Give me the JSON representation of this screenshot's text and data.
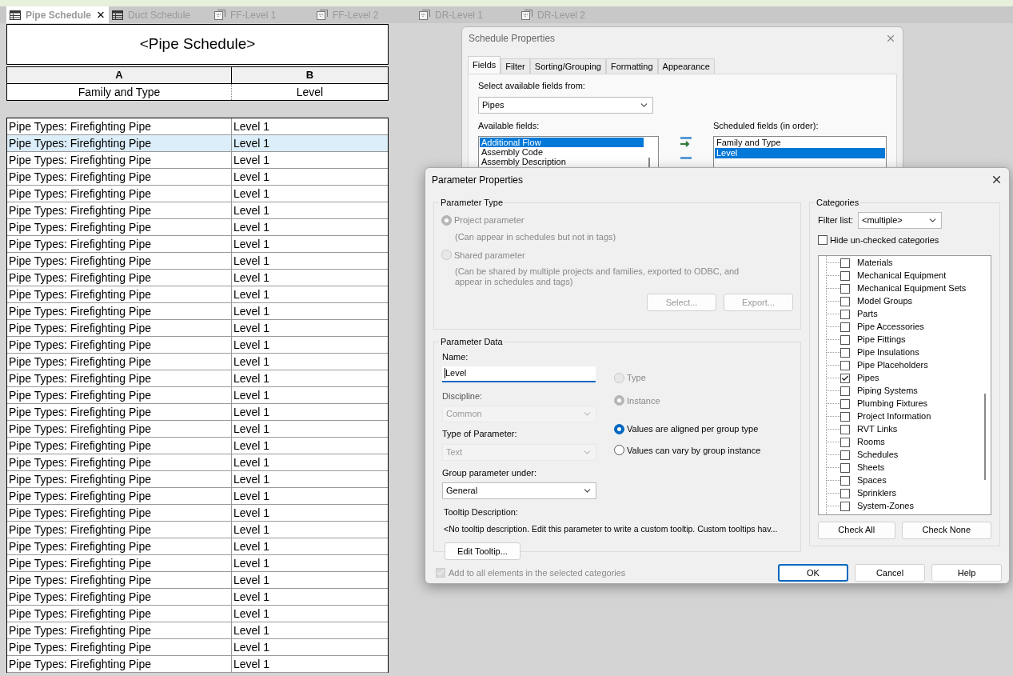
{
  "view_tabs": [
    {
      "label": "Pipe Schedule",
      "kind": "schedule",
      "selected": true
    },
    {
      "label": "Duct Schedule",
      "kind": "schedule",
      "selected": false
    },
    {
      "label": "FF-Level 1",
      "kind": "plan",
      "selected": false
    },
    {
      "label": "FF-Level 2",
      "kind": "plan",
      "selected": false
    },
    {
      "label": "DR-Level 1",
      "kind": "plan",
      "selected": false
    },
    {
      "label": "DR-Level 2",
      "kind": "plan",
      "selected": false
    }
  ],
  "schedule": {
    "title": "<Pipe Schedule>",
    "columns": [
      {
        "letter": "A",
        "heading": "Family and Type"
      },
      {
        "letter": "B",
        "heading": "Level"
      }
    ],
    "rows": [
      {
        "cells": [
          "Pipe Types: Firefighting Pipe",
          "Level 1"
        ],
        "selected": false
      },
      {
        "cells": [
          "Pipe Types: Firefighting Pipe",
          "Level 1"
        ],
        "selected": true
      },
      {
        "cells": [
          "Pipe Types: Firefighting Pipe",
          "Level 1"
        ],
        "selected": false
      },
      {
        "cells": [
          "Pipe Types: Firefighting Pipe",
          "Level 1"
        ],
        "selected": false
      },
      {
        "cells": [
          "Pipe Types: Firefighting Pipe",
          "Level 1"
        ],
        "selected": false
      },
      {
        "cells": [
          "Pipe Types: Firefighting Pipe",
          "Level 1"
        ],
        "selected": false
      },
      {
        "cells": [
          "Pipe Types: Firefighting Pipe",
          "Level 1"
        ],
        "selected": false
      },
      {
        "cells": [
          "Pipe Types: Firefighting Pipe",
          "Level 1"
        ],
        "selected": false
      },
      {
        "cells": [
          "Pipe Types: Firefighting Pipe",
          "Level 1"
        ],
        "selected": false
      },
      {
        "cells": [
          "Pipe Types: Firefighting Pipe",
          "Level 1"
        ],
        "selected": false
      },
      {
        "cells": [
          "Pipe Types: Firefighting Pipe",
          "Level 1"
        ],
        "selected": false
      },
      {
        "cells": [
          "Pipe Types: Firefighting Pipe",
          "Level 1"
        ],
        "selected": false
      },
      {
        "cells": [
          "Pipe Types: Firefighting Pipe",
          "Level 1"
        ],
        "selected": false
      },
      {
        "cells": [
          "Pipe Types: Firefighting Pipe",
          "Level 1"
        ],
        "selected": false
      },
      {
        "cells": [
          "Pipe Types: Firefighting Pipe",
          "Level 1"
        ],
        "selected": false
      },
      {
        "cells": [
          "Pipe Types: Firefighting Pipe",
          "Level 1"
        ],
        "selected": false
      },
      {
        "cells": [
          "Pipe Types: Firefighting Pipe",
          "Level 1"
        ],
        "selected": false
      },
      {
        "cells": [
          "Pipe Types: Firefighting Pipe",
          "Level 1"
        ],
        "selected": false
      },
      {
        "cells": [
          "Pipe Types: Firefighting Pipe",
          "Level 1"
        ],
        "selected": false
      },
      {
        "cells": [
          "Pipe Types: Firefighting Pipe",
          "Level 1"
        ],
        "selected": false
      },
      {
        "cells": [
          "Pipe Types: Firefighting Pipe",
          "Level 1"
        ],
        "selected": false
      },
      {
        "cells": [
          "Pipe Types: Firefighting Pipe",
          "Level 1"
        ],
        "selected": false
      },
      {
        "cells": [
          "Pipe Types: Firefighting Pipe",
          "Level 1"
        ],
        "selected": false
      },
      {
        "cells": [
          "Pipe Types: Firefighting Pipe",
          "Level 1"
        ],
        "selected": false
      },
      {
        "cells": [
          "Pipe Types: Firefighting Pipe",
          "Level 1"
        ],
        "selected": false
      },
      {
        "cells": [
          "Pipe Types: Firefighting Pipe",
          "Level 1"
        ],
        "selected": false
      },
      {
        "cells": [
          "Pipe Types: Firefighting Pipe",
          "Level 1"
        ],
        "selected": false
      },
      {
        "cells": [
          "Pipe Types: Firefighting Pipe",
          "Level 1"
        ],
        "selected": false
      },
      {
        "cells": [
          "Pipe Types: Firefighting Pipe",
          "Level 1"
        ],
        "selected": false
      },
      {
        "cells": [
          "Pipe Types: Firefighting Pipe",
          "Level 1"
        ],
        "selected": false
      },
      {
        "cells": [
          "Pipe Types: Firefighting Pipe",
          "Level 1"
        ],
        "selected": false
      },
      {
        "cells": [
          "Pipe Types: Firefighting Pipe",
          "Level 1"
        ],
        "selected": false
      },
      {
        "cells": [
          "Pipe Types: Firefighting Pipe",
          "Level 1"
        ],
        "selected": false
      }
    ]
  },
  "schedule_properties": {
    "title": "Schedule Properties",
    "tabs": [
      {
        "label": "Fields",
        "selected": true
      },
      {
        "label": "Filter",
        "selected": false
      },
      {
        "label": "Sorting/Grouping",
        "selected": false
      },
      {
        "label": "Formatting",
        "selected": false
      },
      {
        "label": "Appearance",
        "selected": false
      }
    ],
    "source_label": "Select available fields from:",
    "source_value": "Pipes",
    "available_label": "Available fields:",
    "available_fields": [
      {
        "label": "Additional Flow",
        "selected": true
      },
      {
        "label": "Assembly Code",
        "selected": false
      },
      {
        "label": "Assembly Description",
        "selected": false
      }
    ],
    "scheduled_label": "Scheduled fields (in order):",
    "scheduled_fields": [
      {
        "label": "Family and Type",
        "selected": false
      },
      {
        "label": "Level",
        "selected": true
      }
    ]
  },
  "parameter_properties": {
    "title": "Parameter Properties",
    "parameter_type": {
      "legend": "Parameter Type",
      "options": [
        {
          "label": "Project parameter",
          "note": "(Can appear in schedules but not in tags)",
          "selected": true
        },
        {
          "label": "Shared parameter",
          "note": "(Can be shared by multiple projects and families, exported to ODBC, and appear in schedules and tags)",
          "selected": false
        }
      ],
      "select_button": "Select...",
      "export_button": "Export..."
    },
    "parameter_data": {
      "legend": "Parameter Data",
      "name_label": "Name:",
      "name_value": "Level",
      "discipline_label": "Discipline:",
      "discipline_value": "Common",
      "type_label": "Type of Parameter:",
      "type_value": "Text",
      "group_label": "Group parameter under:",
      "group_value": "General",
      "tooltip_label": "Tooltip Description:",
      "tooltip_text": "<No tooltip description. Edit this parameter to write a custom tooltip. Custom tooltips hav...",
      "edit_tooltip_button": "Edit Tooltip...",
      "binding": [
        {
          "label": "Type",
          "selected": false
        },
        {
          "label": "Instance",
          "selected": true
        }
      ],
      "group_values": [
        {
          "label": "Values are aligned per group type",
          "selected": true
        },
        {
          "label": "Values can vary by group instance",
          "selected": false
        }
      ]
    },
    "add_to_all": {
      "label": "Add to all elements in the selected categories",
      "checked": true
    },
    "categories": {
      "legend": "Categories",
      "filter_label": "Filter list:",
      "filter_value": "<multiple>",
      "hide_unchecked": {
        "label": "Hide un-checked categories",
        "checked": false
      },
      "items": [
        {
          "label": "Materials",
          "checked": false
        },
        {
          "label": "Mechanical Equipment",
          "checked": false
        },
        {
          "label": "Mechanical Equipment Sets",
          "checked": false
        },
        {
          "label": "Model Groups",
          "checked": false
        },
        {
          "label": "Parts",
          "checked": false
        },
        {
          "label": "Pipe Accessories",
          "checked": false
        },
        {
          "label": "Pipe Fittings",
          "checked": false
        },
        {
          "label": "Pipe Insulations",
          "checked": false
        },
        {
          "label": "Pipe Placeholders",
          "checked": false
        },
        {
          "label": "Pipes",
          "checked": true
        },
        {
          "label": "Piping Systems",
          "checked": false
        },
        {
          "label": "Plumbing Fixtures",
          "checked": false
        },
        {
          "label": "Project Information",
          "checked": false
        },
        {
          "label": "RVT Links",
          "checked": false
        },
        {
          "label": "Rooms",
          "checked": false
        },
        {
          "label": "Schedules",
          "checked": false
        },
        {
          "label": "Sheets",
          "checked": false
        },
        {
          "label": "Spaces",
          "checked": false
        },
        {
          "label": "Sprinklers",
          "checked": false
        },
        {
          "label": "System-Zones",
          "checked": false
        }
      ],
      "check_all": "Check All",
      "check_none": "Check None"
    },
    "buttons": [
      {
        "label": "OK",
        "default": true
      },
      {
        "label": "Cancel",
        "default": false
      },
      {
        "label": "Help",
        "default": false
      }
    ]
  }
}
